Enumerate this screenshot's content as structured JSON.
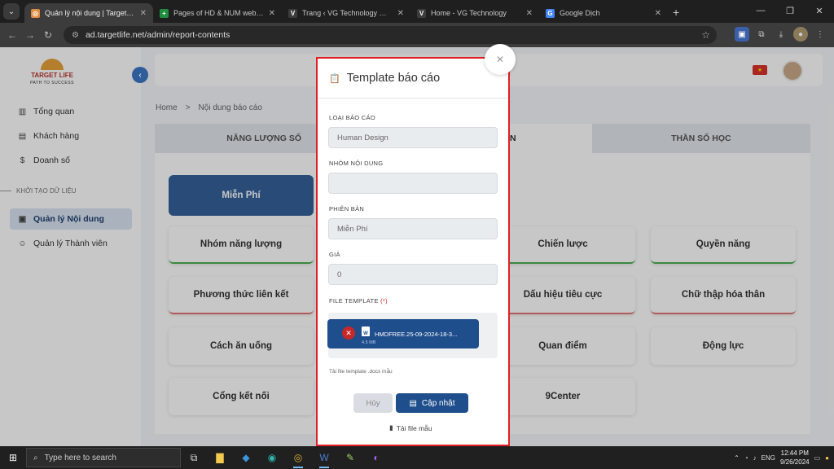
{
  "browser": {
    "tabs": [
      {
        "title": "Quản lý nội dung | Target Life",
        "fav_color": "#e08a3c",
        "fav_glyph": "◎",
        "active": true
      },
      {
        "title": "Pages of HD & NUM web - Goo",
        "fav_color": "#1e8e3e",
        "fav_glyph": "+",
        "active": false
      },
      {
        "title": "Trang ‹ VG Technology — Word",
        "fav_color": "#3c3c3c",
        "fav_glyph": "V",
        "active": false
      },
      {
        "title": "Home - VG Technology",
        "fav_color": "#3c3c3c",
        "fav_glyph": "V",
        "active": false
      },
      {
        "title": "Google Dịch",
        "fav_color": "#4285f4",
        "fav_glyph": "G",
        "active": false
      }
    ],
    "url": "ad.targetlife.net/admin/report-contents"
  },
  "sidebar": {
    "logo_brand": "TARGET LIFE",
    "logo_slogan": "PATH TO SUCCESS",
    "items": [
      {
        "label": "Tổng quan",
        "icon": "chart-icon"
      },
      {
        "label": "Khách hàng",
        "icon": "user-card-icon"
      },
      {
        "label": "Doanh số",
        "icon": "dollar-icon"
      }
    ],
    "section_label": "KHỞI TẠO DỮ LIỆU",
    "data_items": [
      {
        "label": "Quản lý Nội dung",
        "icon": "book-icon",
        "active": true
      },
      {
        "label": "Quản lý Thành viên",
        "icon": "users-icon",
        "active": false
      }
    ]
  },
  "breadcrumb": {
    "home": "Home",
    "sep": ">",
    "current": "Nội dung báo cáo"
  },
  "content_tabs": [
    "NĂNG LƯỢNG SỐ",
    "HUMAN DESIGN",
    "THẦN SỐ HỌC"
  ],
  "selected_plan": "Miễn Phí",
  "content_buttons": [
    "Nhóm năng lượng",
    "Chiến lược",
    "Quyền năng",
    "Phương thức liên kết",
    "Dấu hiệu tiêu cực",
    "Chữ thập hóa thân",
    "Cách ăn uống",
    "Quan điểm",
    "Động lực",
    "Cổng kết nối",
    "9Center"
  ],
  "modal": {
    "title": "Template báo cáo",
    "fields": {
      "report_label": "LOẠI BÁO CÁO",
      "report_value": "Human Design",
      "group_label": "NHÓM NỘI DUNG",
      "group_value": "",
      "version_label": "PHIÊN BẢN",
      "version_value": "Miễn Phí",
      "price_label": "GIÁ",
      "price_value": "0",
      "file_label": "FILE TEMPLATE",
      "file_required": "(*)"
    },
    "file": {
      "name": "HMDFREE.25-09-2024-18-3...",
      "size": "4.5 MB"
    },
    "hint": "Tải file template .docx mẫu",
    "cancel_label": "Hủy",
    "update_label": "Cập nhật",
    "download_label": "Tải file mẫu"
  },
  "taskbar": {
    "search_placeholder": "Type here to search",
    "lang": "ENG",
    "time": "12:44 PM",
    "date": "9/26/2024"
  },
  "colors": {
    "brand_blue": "#1f4e8c",
    "highlight_red": "#e31e24"
  }
}
